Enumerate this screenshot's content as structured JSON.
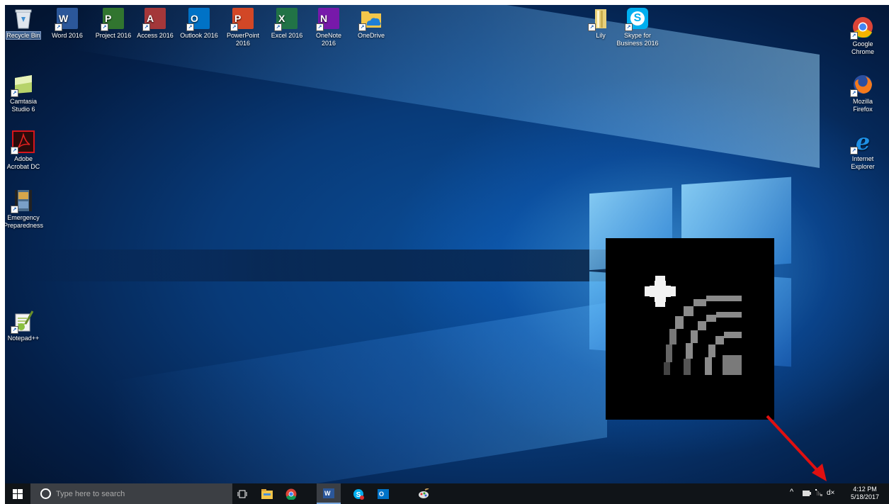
{
  "desktop": {
    "icons_top": [
      {
        "label": "Recycle Bin"
      },
      {
        "label": "Word 2016",
        "letter": "W",
        "color": "#2b579a"
      },
      {
        "label": "Project 2016",
        "letter": "P",
        "color": "#31752f"
      },
      {
        "label": "Access 2016",
        "letter": "A",
        "color": "#a4373a"
      },
      {
        "label": "Outlook 2016",
        "letter": "O",
        "color": "#0072c6"
      },
      {
        "label": "PowerPoint 2016",
        "letter": "P",
        "color": "#d24726"
      },
      {
        "label": "Excel 2016",
        "letter": "X",
        "color": "#217346"
      },
      {
        "label": "OneNote 2016",
        "letter": "N",
        "color": "#7719aa"
      },
      {
        "label": "OneDrive"
      }
    ],
    "icon_lily": {
      "label": "Lily"
    },
    "icon_skype": {
      "label": "Skype for Business 2016",
      "letter": "S",
      "color": "#00aff0"
    },
    "icons_left": [
      {
        "label": "Camtasia Studio 6"
      },
      {
        "label": "Adobe Acrobat DC"
      },
      {
        "label": "Emergency Preparedness"
      },
      {
        "label": "Notepad++"
      }
    ],
    "icons_right": [
      {
        "label": "Google Chrome"
      },
      {
        "label": "Mozilla Firefox"
      },
      {
        "label": "Internet Explorer",
        "letter": "e"
      }
    ]
  },
  "callout": {
    "description": "zoomed view of network status icon",
    "arrow_color": "#e01010"
  },
  "taskbar": {
    "search_placeholder": "Type here to search",
    "pinned": [
      "task-view",
      "file-explorer",
      "chrome",
      "word",
      "skype",
      "outlook",
      "paint"
    ],
    "tray": {
      "time": "4:12 PM",
      "date": "5/18/2017",
      "volume_glyph": "d×",
      "chevron": "^"
    }
  }
}
